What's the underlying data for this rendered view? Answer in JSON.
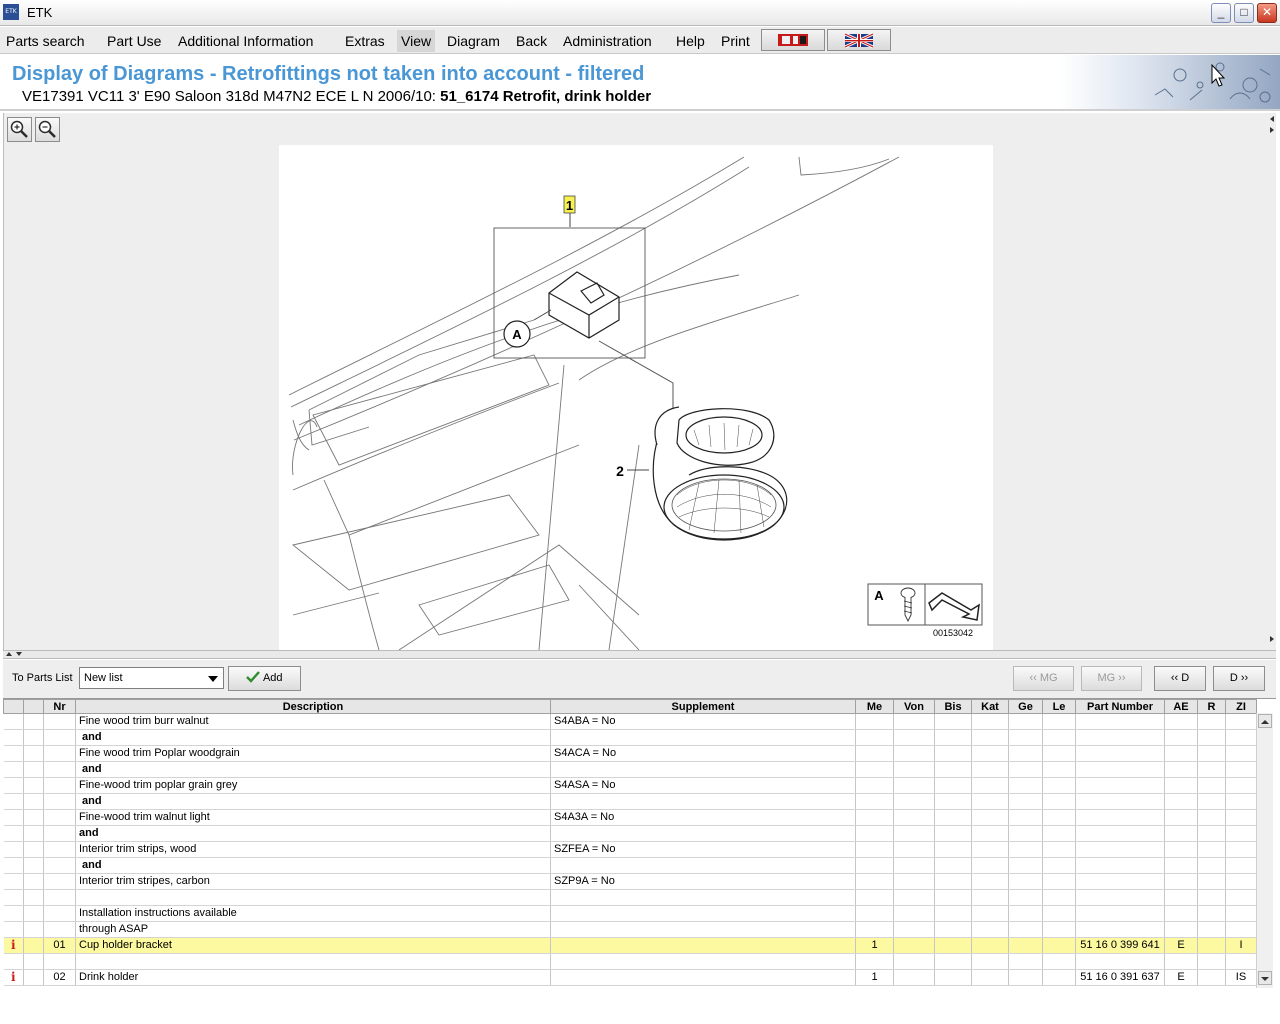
{
  "window": {
    "title": "ETK",
    "icon_text": "ETK"
  },
  "menu": {
    "items": [
      {
        "label": "Parts search"
      },
      {
        "label": "Part Use"
      },
      {
        "label": "Additional Information"
      },
      {
        "label": "Extras"
      },
      {
        "label": "View"
      },
      {
        "label": "Diagram"
      },
      {
        "label": "Back"
      },
      {
        "label": "Administration"
      },
      {
        "label": "Help"
      },
      {
        "label": "Print"
      }
    ],
    "active": "View"
  },
  "header": {
    "title": "Display of Diagrams - Retrofittings not taken into account - filtered",
    "vehicle": "VE17391 VC11 3' E90 Saloon 318d M47N2 ECE L N 2006/10: ",
    "group": "51_6174 Retrofit, drink holder"
  },
  "diagram": {
    "callouts": [
      "1",
      "A",
      "2"
    ],
    "legend_letter": "A",
    "image_number": "00153042"
  },
  "controls": {
    "to_parts_list_label": "To Parts List",
    "list_value": "New list",
    "add_label": "Add",
    "prev_mg": "MG",
    "next_mg": "MG",
    "prev_d": "D",
    "next_d": "D"
  },
  "table": {
    "headers": [
      "",
      "",
      "Nr",
      "Description",
      "Supplement",
      "Me",
      "Von",
      "Bis",
      "Kat",
      "Ge",
      "Le",
      "Part Number",
      "AE",
      "R",
      "ZI"
    ],
    "rows": [
      {
        "info": "",
        "nr": "",
        "desc": "Fine wood trim burr walnut",
        "supp": "S4ABA = No",
        "me": "",
        "part": "",
        "ae": "",
        "zi": "",
        "bold": false,
        "hl": false
      },
      {
        "info": "",
        "nr": "",
        "desc": "and",
        "supp": "",
        "me": "",
        "part": "",
        "ae": "",
        "zi": "",
        "bold": true,
        "hl": false
      },
      {
        "info": "",
        "nr": "",
        "desc": "Fine wood trim Poplar woodgrain",
        "supp": "S4ACA = No",
        "me": "",
        "part": "",
        "ae": "",
        "zi": "",
        "bold": false,
        "hl": false
      },
      {
        "info": "",
        "nr": "",
        "desc": "and",
        "supp": "",
        "me": "",
        "part": "",
        "ae": "",
        "zi": "",
        "bold": true,
        "hl": false
      },
      {
        "info": "",
        "nr": "",
        "desc": "Fine-wood trim poplar grain grey",
        "supp": "S4ASA = No",
        "me": "",
        "part": "",
        "ae": "",
        "zi": "",
        "bold": false,
        "hl": false
      },
      {
        "info": "",
        "nr": "",
        "desc": "and",
        "supp": "",
        "me": "",
        "part": "",
        "ae": "",
        "zi": "",
        "bold": true,
        "hl": false
      },
      {
        "info": "",
        "nr": "",
        "desc": "Fine-wood trim walnut light",
        "supp": "S4A3A = No",
        "me": "",
        "part": "",
        "ae": "",
        "zi": "",
        "bold": false,
        "hl": false
      },
      {
        "info": "",
        "nr": "",
        "desc": "and",
        "supp": "",
        "me": "",
        "part": "",
        "ae": "",
        "zi": "",
        "bold": true,
        "hl": false
      },
      {
        "info": "",
        "nr": "",
        "desc": "Interior trim strips, wood",
        "supp": "SZFEA = No",
        "me": "",
        "part": "",
        "ae": "",
        "zi": "",
        "bold": false,
        "hl": false
      },
      {
        "info": "",
        "nr": "",
        "desc": "and",
        "supp": "",
        "me": "",
        "part": "",
        "ae": "",
        "zi": "",
        "bold": true,
        "hl": false
      },
      {
        "info": "",
        "nr": "",
        "desc": "Interior trim stripes, carbon",
        "supp": "SZP9A = No",
        "me": "",
        "part": "",
        "ae": "",
        "zi": "",
        "bold": false,
        "hl": false
      },
      {
        "info": "",
        "nr": "",
        "desc": "",
        "supp": "",
        "me": "",
        "part": "",
        "ae": "",
        "zi": "",
        "bold": false,
        "hl": false
      },
      {
        "info": "",
        "nr": "",
        "desc": "Installation instructions available",
        "supp": "",
        "me": "",
        "part": "",
        "ae": "",
        "zi": "",
        "bold": false,
        "hl": false
      },
      {
        "info": "",
        "nr": "",
        "desc": "through ASAP",
        "supp": "",
        "me": "",
        "part": "",
        "ae": "",
        "zi": "",
        "bold": false,
        "hl": false
      },
      {
        "info": "i",
        "nr": "01",
        "desc": "Cup holder bracket",
        "supp": "",
        "me": "1",
        "part": "51 16 0 399 641",
        "ae": "E",
        "zi": "I",
        "bold": false,
        "hl": true
      },
      {
        "info": "",
        "nr": "",
        "desc": "",
        "supp": "",
        "me": "",
        "part": "",
        "ae": "",
        "zi": "",
        "bold": false,
        "hl": false
      },
      {
        "info": "i",
        "nr": "02",
        "desc": "Drink holder",
        "supp": "",
        "me": "1",
        "part": "51 16 0 391 637",
        "ae": "E",
        "zi": "IS",
        "bold": false,
        "hl": false
      }
    ]
  },
  "colors": {
    "title_blue": "#4a97d6",
    "highlight_row": "#fdf9a0",
    "info_icon": "#c8201c"
  }
}
